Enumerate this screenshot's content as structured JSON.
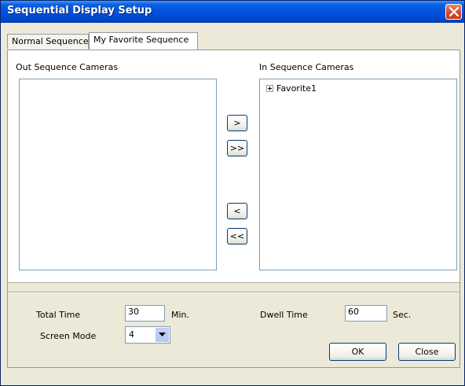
{
  "window": {
    "title": "Sequential Display Setup",
    "close_icon": "close-icon"
  },
  "tabs": [
    {
      "label": "Normal Sequence",
      "selected": false
    },
    {
      "label": "My Favorite Sequence",
      "selected": true
    }
  ],
  "out_list": {
    "label": "Out Sequence Cameras",
    "items": []
  },
  "in_list": {
    "label": "In Sequence Cameras",
    "items": [
      {
        "label": "Favorite1",
        "expander_icon": "plus-expander-icon"
      }
    ]
  },
  "move_buttons": {
    "add": ">",
    "add_all": ">>",
    "remove": "<",
    "remove_all": "<<"
  },
  "settings": {
    "total_time": {
      "label": "Total Time",
      "value": "30",
      "unit": "Min."
    },
    "dwell_time": {
      "label": "Dwell Time",
      "value": "60",
      "unit": "Sec."
    },
    "screen_mode": {
      "label": "Screen Mode",
      "value": "4"
    }
  },
  "buttons": {
    "ok": "OK",
    "close": "Close"
  },
  "colors": {
    "titlebar": "#0054e3",
    "close_button": "#d3492c",
    "dialog_bg": "#ece9d8"
  }
}
